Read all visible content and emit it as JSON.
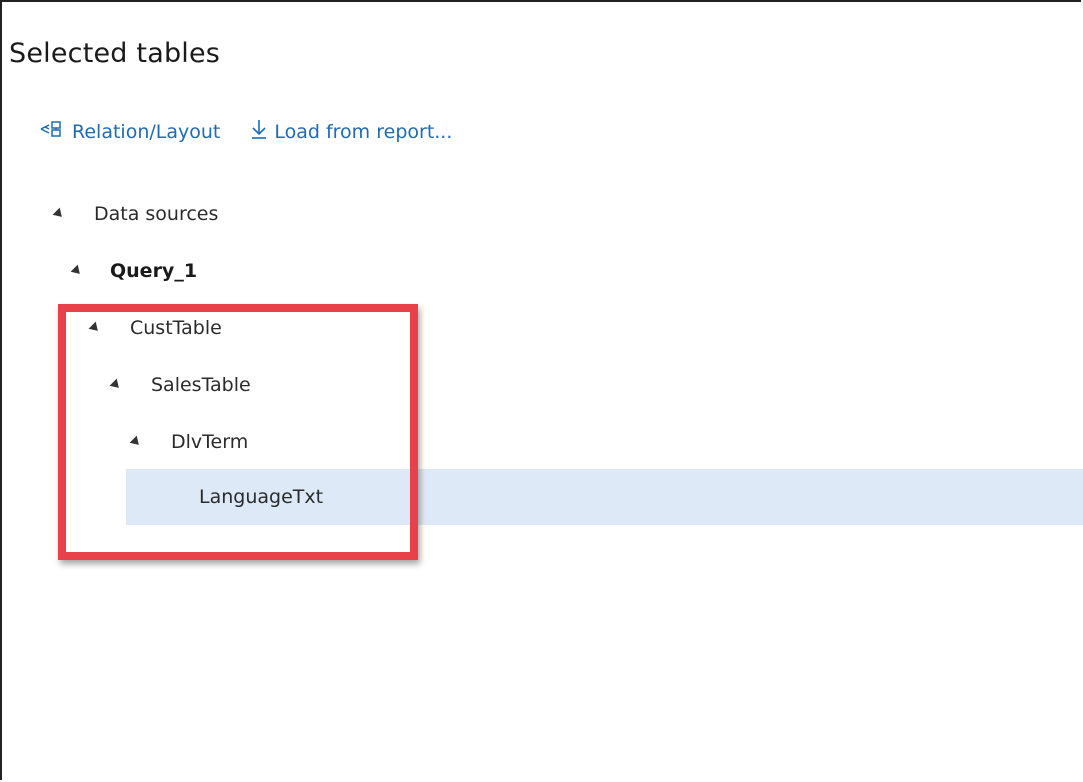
{
  "panel": {
    "title": "Selected tables"
  },
  "toolbar": {
    "relation_label": "Relation/Layout",
    "relation_icon": "relation-icon",
    "load_label": "Load from report...",
    "load_icon": "download-arrow-icon",
    "link_color": "#1f6bb5"
  },
  "tree": {
    "data_sources": "Data sources",
    "query": "Query_1",
    "cust_table": "CustTable",
    "sales_table": "SalesTable",
    "dlv_term": "DlvTerm",
    "language_txt": "LanguageTxt"
  },
  "colors": {
    "selected_row": "#dde9f6",
    "highlight": "#e8414a"
  }
}
